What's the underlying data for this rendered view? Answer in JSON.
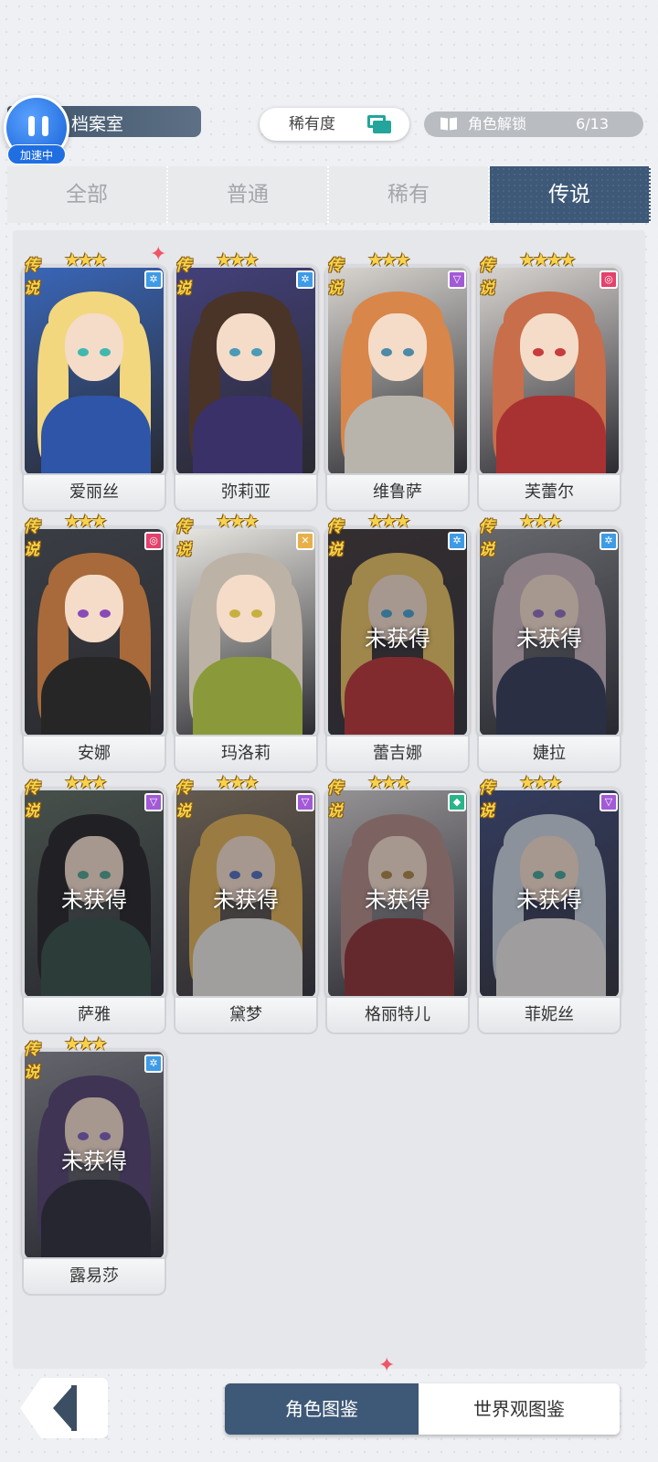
{
  "header": {
    "title": "档案室",
    "speed_badge": "加速中",
    "rarity_button": "稀有度",
    "unlock_label": "角色解锁",
    "unlock_count": "6/13"
  },
  "tabs": [
    {
      "label": "全部",
      "active": false
    },
    {
      "label": "普通",
      "active": false
    },
    {
      "label": "稀有",
      "active": false
    },
    {
      "label": "传说",
      "active": true
    }
  ],
  "rarity_label": "传说",
  "unacquired_label": "未获得",
  "characters": [
    {
      "name": "爱丽丝",
      "acquired": true,
      "stars": 3,
      "element": "ice",
      "element_color": "#3f9be6",
      "hair": "#f2d77e",
      "dress": "#2e55a8",
      "bg": "#3966b8",
      "eye": "#40b8b0"
    },
    {
      "name": "弥莉亚",
      "acquired": true,
      "stars": 3,
      "element": "ice",
      "element_color": "#3f9be6",
      "hair": "#4a3428",
      "dress": "#3a3168",
      "bg": "#43407a",
      "eye": "#4a9ab8"
    },
    {
      "name": "维鲁萨",
      "acquired": true,
      "stars": 3,
      "element": "dark",
      "element_color": "#a25ad6",
      "hair": "#d9864a",
      "dress": "#b8b4ac",
      "bg": "#d9d6d0",
      "eye": "#4c8aa8"
    },
    {
      "name": "芙蕾尔",
      "acquired": true,
      "stars": 4,
      "element": "fire",
      "element_color": "#e4416c",
      "hair": "#c86e4a",
      "dress": "#a83232",
      "bg": "#d8d4d0",
      "eye": "#c83c3c"
    },
    {
      "name": "安娜",
      "acquired": true,
      "stars": 3,
      "element": "fire",
      "element_color": "#e4416c",
      "hair": "#a86a3a",
      "dress": "#262626",
      "bg": "#3a3e44",
      "eye": "#8a4ab8"
    },
    {
      "name": "玛洛莉",
      "acquired": true,
      "stars": 3,
      "element": "light",
      "element_color": "#e8b04a",
      "hair": "#bcb3a6",
      "dress": "#8a9a3a",
      "bg": "#e8e6e0",
      "eye": "#c8b040"
    },
    {
      "name": "蕾吉娜",
      "acquired": false,
      "stars": 3,
      "element": "ice",
      "element_color": "#3f9be6",
      "hair": "#e9c05a",
      "dress": "#b82e2e",
      "bg": "#3c3230",
      "eye": "#40a0c8"
    },
    {
      "name": "婕拉",
      "acquired": false,
      "stars": 3,
      "element": "ice",
      "element_color": "#3f9be6",
      "hair": "#c8b4b8",
      "dress": "#2c3450",
      "bg": "#8c9090",
      "eye": "#8a6ab8"
    },
    {
      "name": "萨雅",
      "acquired": false,
      "stars": 3,
      "element": "dark",
      "element_color": "#a25ad6",
      "hair": "#1e1e1e",
      "dress": "#2e4a3e",
      "bg": "#5a6a5a",
      "eye": "#4aa088"
    },
    {
      "name": "黛梦",
      "acquired": false,
      "stars": 3,
      "element": "dark",
      "element_color": "#a25ad6",
      "hair": "#e0b04c",
      "dress": "#ece8e0",
      "bg": "#8a7a60",
      "eye": "#4a6ab8"
    },
    {
      "name": "格丽特儿",
      "acquired": false,
      "stars": 3,
      "element": "wind",
      "element_color": "#2ab48a",
      "hair": "#b08880",
      "dress": "#8a2a2a",
      "bg": "#d8d4d0",
      "eye": "#a8843a"
    },
    {
      "name": "菲妮丝",
      "acquired": false,
      "stars": 3,
      "element": "dark",
      "element_color": "#a25ad6",
      "hair": "#c8d4dc",
      "dress": "#e8e6e0",
      "bg": "#3c4a7a",
      "eye": "#40a090"
    },
    {
      "name": "露易莎",
      "acquired": false,
      "stars": 3,
      "element": "ice",
      "element_color": "#3f9be6",
      "hair": "#4e3c6a",
      "dress": "#262630",
      "bg": "#8a8a90",
      "eye": "#7a5ab8"
    }
  ],
  "bottom_tabs": [
    {
      "label": "角色图鉴",
      "active": true
    },
    {
      "label": "世界观图鉴",
      "active": false
    }
  ]
}
